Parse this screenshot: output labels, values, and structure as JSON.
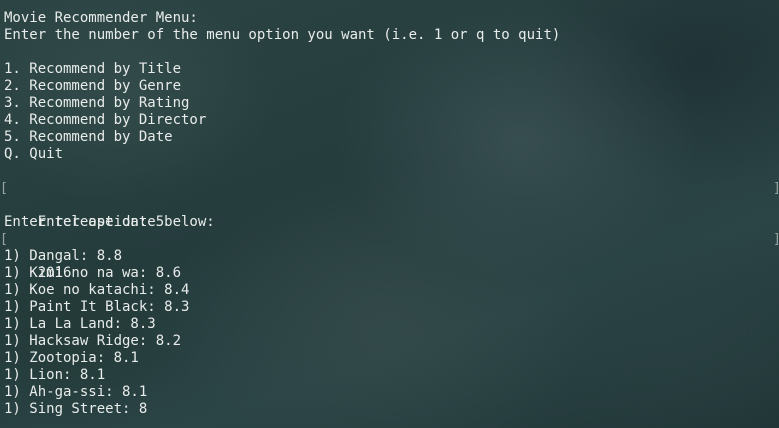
{
  "terminal": {
    "header": {
      "title": "Movie Recommender Menu:",
      "instruction": "Enter the number of the menu option you want (i.e. 1 or q to quit)"
    },
    "menu_items": [
      "1. Recommend by Title",
      "2. Recommend by Genre",
      "3. Recommend by Rating",
      "4. Recommend by Director",
      "5. Recommend by Date",
      "Q. Quit"
    ],
    "option_prompt": "Enter option: 5",
    "date_prompt": "Enter release date below:",
    "date_input": "2016",
    "results": [
      "1) Dangal: 8.8",
      "1) Kimi no na wa: 8.6",
      "1) Koe no katachi: 8.4",
      "1) Paint It Black: 8.3",
      "1) La La Land: 8.3",
      "1) Hacksaw Ridge: 8.2",
      "1) Zootopia: 8.1",
      "1) Lion: 8.1",
      "1) Ah-ga-ssi: 8.1",
      "1) Sing Street: 8"
    ],
    "mark_left": "[",
    "mark_right": "]"
  }
}
